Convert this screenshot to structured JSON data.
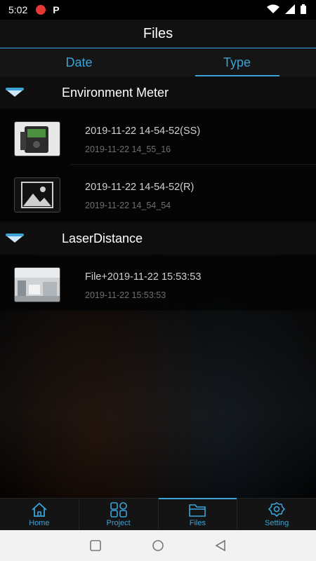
{
  "status_bar": {
    "time": "5:02",
    "p_badge": "P"
  },
  "app_bar": {
    "title": "Files"
  },
  "tabs": [
    {
      "label": "Date"
    },
    {
      "label": "Type",
      "active": true
    }
  ],
  "groups": [
    {
      "title": "Environment Meter",
      "items": [
        {
          "title": "2019-11-22 14-54-52(SS)",
          "subtitle": "2019-11-22 14_55_16",
          "thumb": "device-photo"
        },
        {
          "title": "2019-11-22 14-54-52(R)",
          "subtitle": "2019-11-22 14_54_54",
          "thumb": "image-placeholder-icon"
        }
      ]
    },
    {
      "title": "LaserDistance",
      "items": [
        {
          "title": "File+2019-11-22 15:53:53",
          "subtitle": "2019-11-22 15:53:53",
          "thumb": "room-photo"
        }
      ]
    }
  ],
  "bottom_nav": [
    {
      "label": "Home",
      "icon": "home-icon"
    },
    {
      "label": "Project",
      "icon": "grid-icon"
    },
    {
      "label": "Files",
      "icon": "folder-icon",
      "active": true
    },
    {
      "label": "Setting",
      "icon": "gear-icon"
    }
  ],
  "colors": {
    "accent": "#3aa3d8",
    "background": "#000000"
  }
}
